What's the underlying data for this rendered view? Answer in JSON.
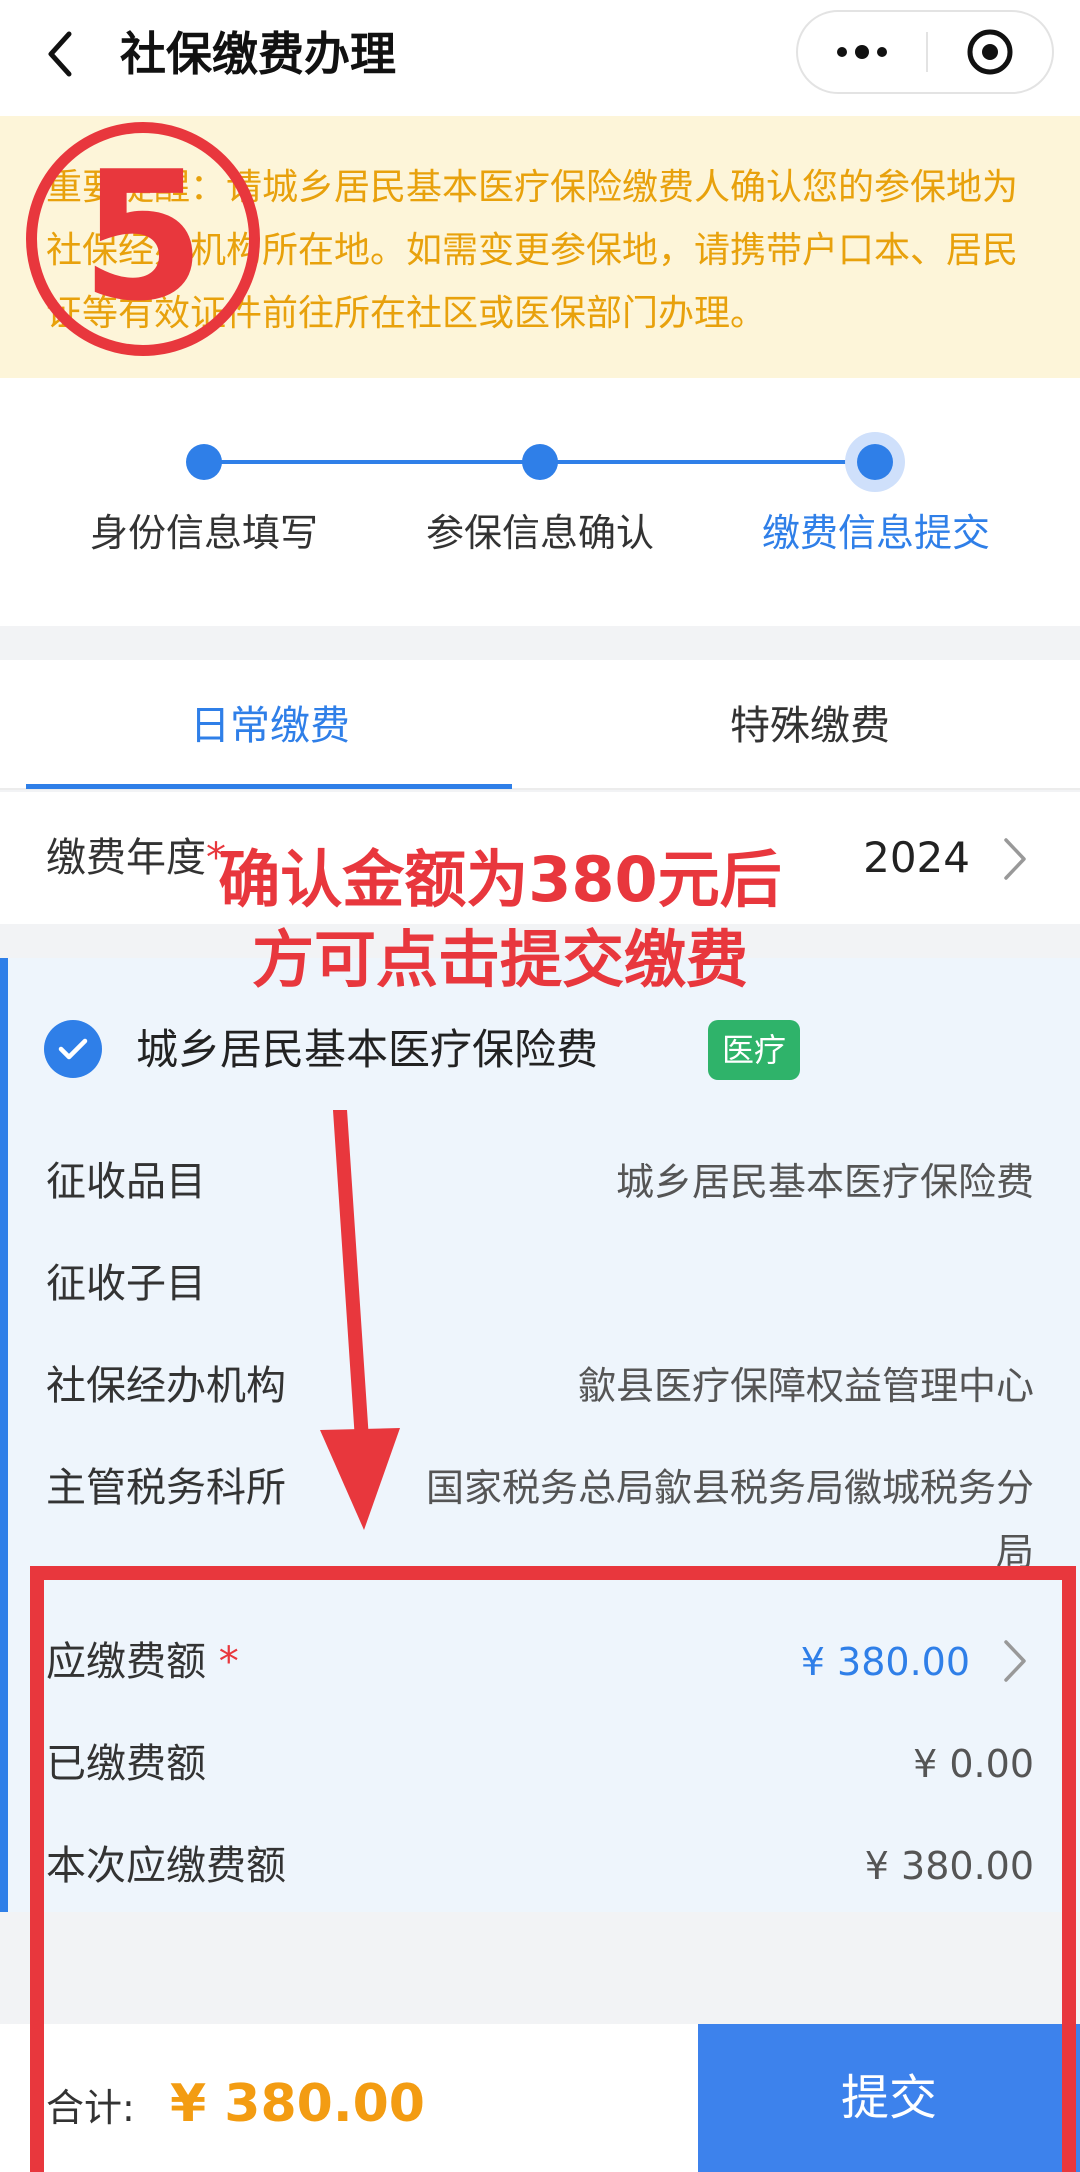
{
  "header": {
    "title": "社保缴费办理"
  },
  "notice": {
    "text": "重要提醒：请城乡居民基本医疗保险缴费人确认您的参保地为社保经办机构所在地。如需变更参保地，请携带户口本、居民证等有效证件前往所在社区或医保部门办理。"
  },
  "annotation": {
    "step_number": "5",
    "line1": "确认金额为380元后",
    "line2": "方可点击提交缴费"
  },
  "steps": [
    {
      "label": "身份信息填写"
    },
    {
      "label": "参保信息确认"
    },
    {
      "label": "缴费信息提交"
    }
  ],
  "tabs": [
    {
      "label": "日常缴费"
    },
    {
      "label": "特殊缴费"
    }
  ],
  "year": {
    "label": "缴费年度",
    "value": "2024"
  },
  "insurance": {
    "name": "城乡居民基本医疗保险费",
    "tag": "医疗",
    "rows": [
      {
        "label": "征收品目",
        "value": "城乡居民基本医疗保险费"
      },
      {
        "label": "征收子目",
        "value": ""
      },
      {
        "label": "社保经办机构",
        "value": "歙县医疗保障权益管理中心"
      },
      {
        "label": "主管税务科所",
        "value": "国家税务总局歙县税务局徽城税务分局"
      }
    ],
    "amount_due_label": "应缴费额",
    "amount_due": "¥ 380.00",
    "paid_label": "已缴费额",
    "paid": "¥ 0.00",
    "current_due_label": "本次应缴费额",
    "current_due": "¥ 380.00"
  },
  "footer": {
    "total_label": "合计:",
    "total_value": "¥ 380.00",
    "submit_label": "提交"
  },
  "colors": {
    "primary": "#2f7fe8",
    "warning_text": "#e8a10c",
    "notice_bg": "#fdf5d9",
    "annotation_red": "#e8373d",
    "tag_green": "#2fb36a",
    "total_orange": "#f39c12"
  }
}
